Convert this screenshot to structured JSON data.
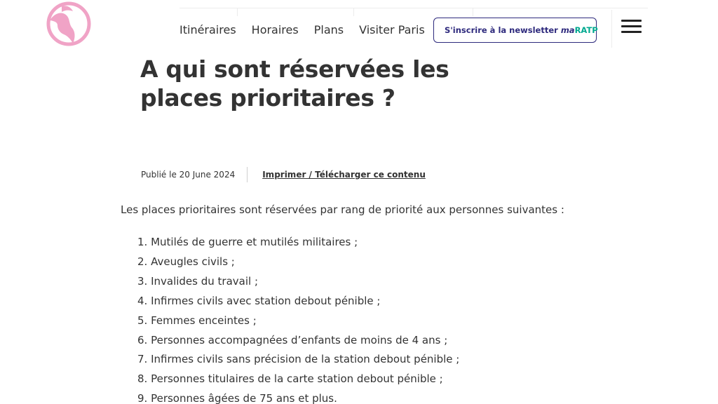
{
  "header": {
    "logo_icon": "ratp-logo",
    "nav": [
      "Itinéraires",
      "Horaires",
      "Plans",
      "Visiter Paris"
    ],
    "newsletter": {
      "icon": "bell-icon",
      "label": "S'inscrire à la newsletter",
      "brand_ma": "ma",
      "brand_ratp": "RATP"
    },
    "menu_icon": "hamburger-menu-icon"
  },
  "article": {
    "title": "A qui sont réservées les places prioritaires ?",
    "published": "Publié le 20 June 2024",
    "print_link": "Imprimer / Télécharger ce contenu",
    "intro": "Les places prioritaires sont réservées par rang de priorité aux personnes suivantes :",
    "priorities": [
      "1. Mutilés de guerre et mutilés militaires ;",
      "2. Aveugles civils ;",
      "3. Invalides du travail ;",
      "4. Infirmes civils avec station debout pénible ;",
      "5. Femmes enceintes ;",
      "6. Personnes accompagnées d’enfants de moins de 4 ans ;",
      "7. Infirmes civils sans précision de la station debout pénible ;",
      "8. Personnes titulaires de la carte station debout pénible ;",
      "9. Personnes âgées de 75 ans et plus."
    ]
  },
  "colors": {
    "logo_pink": "#f0a3c6",
    "brand_navy": "#2e2a7d",
    "brand_teal": "#00a88f",
    "text": "#333333"
  }
}
